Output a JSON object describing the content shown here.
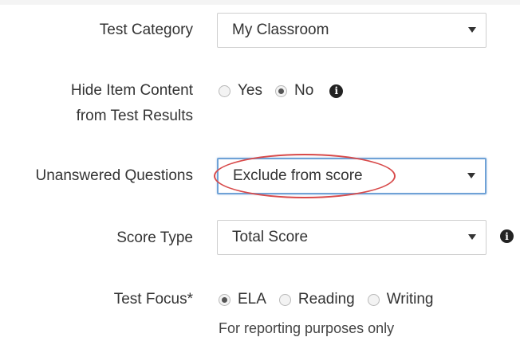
{
  "test_category": {
    "label": "Test Category",
    "value": "My Classroom"
  },
  "hide_item_content": {
    "label_line1": "Hide Item Content",
    "label_line2": "from Test Results",
    "options": [
      "Yes",
      "No"
    ],
    "selected": "No",
    "info_icon": "info-icon"
  },
  "unanswered_questions": {
    "label": "Unanswered Questions",
    "value": "Exclude from score",
    "highlight_color": "#d84a4a"
  },
  "score_type": {
    "label": "Score Type",
    "value": "Total Score",
    "info_icon": "info-icon"
  },
  "test_focus": {
    "label": "Test Focus*",
    "options": [
      "ELA",
      "Reading",
      "Writing"
    ],
    "selected": "ELA",
    "note": "For reporting purposes only"
  }
}
